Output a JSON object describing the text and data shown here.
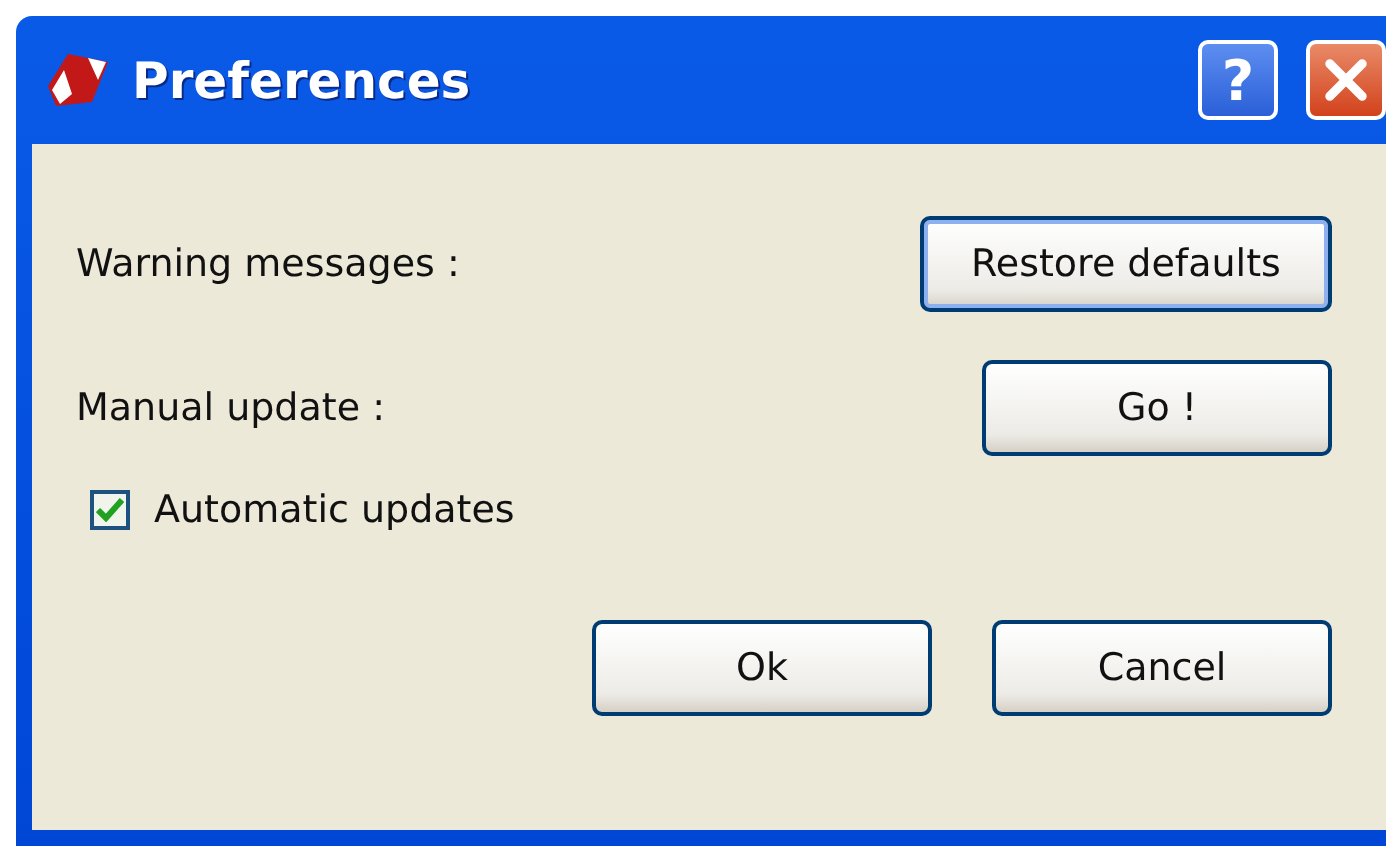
{
  "window": {
    "title": "Preferences",
    "help_button": "?"
  },
  "rows": [
    {
      "label": "Warning messages :",
      "button": "Restore defaults"
    },
    {
      "label": "Manual update :",
      "button": "Go !"
    }
  ],
  "checkbox": {
    "label": "Automatic updates",
    "checked": true
  },
  "buttons": [
    "Ok",
    "Cancel"
  ]
}
